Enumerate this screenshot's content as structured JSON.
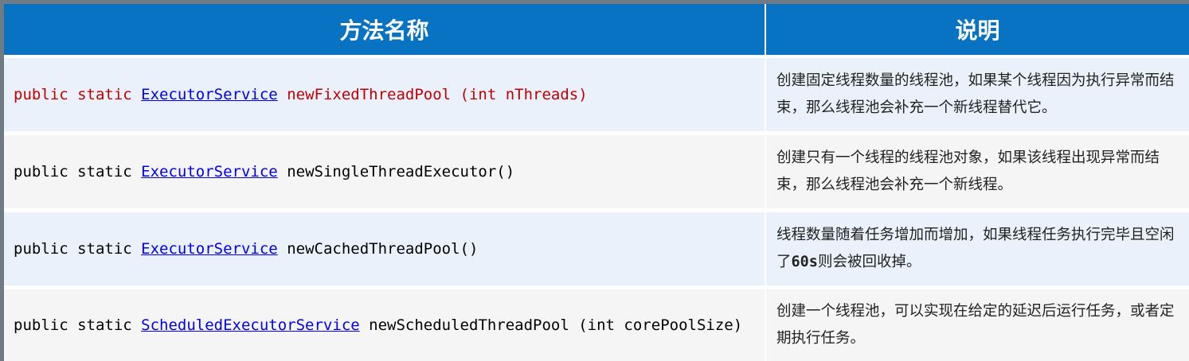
{
  "headers": {
    "method_name": "方法名称",
    "description": "说明"
  },
  "rows": [
    {
      "prefix": "public static ",
      "type": "ExecutorService",
      "suffix": " newFixedThreadPool (int nThreads)",
      "desc_before": "创建固定线程数量的线程池，如果某个线程因为执行异常而结束，那么线程池会补充一个新线程替代它。",
      "desc_code": "",
      "desc_after": ""
    },
    {
      "prefix": "public static ",
      "type": "ExecutorService",
      "suffix": " newSingleThreadExecutor()",
      "desc_before": "创建只有一个线程的线程池对象，如果该线程出现异常而结束，那么线程池会补充一个新线程。",
      "desc_code": "",
      "desc_after": ""
    },
    {
      "prefix": "public static ",
      "type": "ExecutorService",
      "suffix": " newCachedThreadPool()",
      "desc_before": "线程数量随着任务增加而增加，如果线程任务执行完毕且空闲了",
      "desc_code": "60s",
      "desc_after": "则会被回收掉。"
    },
    {
      "prefix": "public static ",
      "type": "ScheduledExecutorService",
      "suffix": " newScheduledThreadPool (int corePoolSize)",
      "desc_before": "创建一个线程池，可以实现在给定的延迟后运行任务，或者定期执行任务。",
      "desc_code": "",
      "desc_after": ""
    }
  ],
  "colors": {
    "header_bg": "#0873c2",
    "highlight_text": "#c00000",
    "link": "#0000ee"
  }
}
